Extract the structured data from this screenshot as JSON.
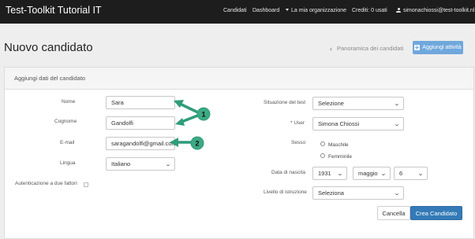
{
  "navbar": {
    "brand": "Test-Toolkit Tutorial IT",
    "links": {
      "candidati": "Candidati",
      "dashboard": "Dashboard",
      "organizzazione": "La mia organizzazione",
      "crediti": "Crediti: 0 usati",
      "user": "simonachiossi@test-toolkit.nl"
    }
  },
  "page": {
    "title": "Nuovo candidato",
    "panoramica_label": "Panoramica dei candidati",
    "aggiungi_label": "Aggiungi attività"
  },
  "panel": {
    "title": "Aggiungi dati del candidato"
  },
  "form_left": {
    "nome": {
      "label": "Nome",
      "value": "Sara"
    },
    "cognome": {
      "label": "Cognome",
      "value": "Gandolfi"
    },
    "email": {
      "label": "E-mail",
      "value": "saragandolfi@gmail.com"
    },
    "lingua": {
      "label": "Lingua",
      "value": "Italiano"
    },
    "two_factor": {
      "label": "Autenticazione a due fattori"
    }
  },
  "form_right": {
    "situazione": {
      "label": "Situazione del test",
      "value": "Selezione"
    },
    "user": {
      "label": "* User",
      "value": "Simona Chiossi"
    },
    "sesso": {
      "label": "Sesso",
      "options": [
        "Maschile",
        "Femminile"
      ]
    },
    "nascita": {
      "label": "Data di nascita",
      "year": "1931",
      "month": "maggio",
      "day": "6"
    },
    "istruzione": {
      "label": "Livello di istruzione",
      "value": "Seleziona"
    }
  },
  "actions": {
    "cancel": "Cancella",
    "create": "Crea Candidato"
  },
  "annotations": {
    "badge_1": "1",
    "badge_2": "2",
    "arrow_color": "#3daa84"
  }
}
